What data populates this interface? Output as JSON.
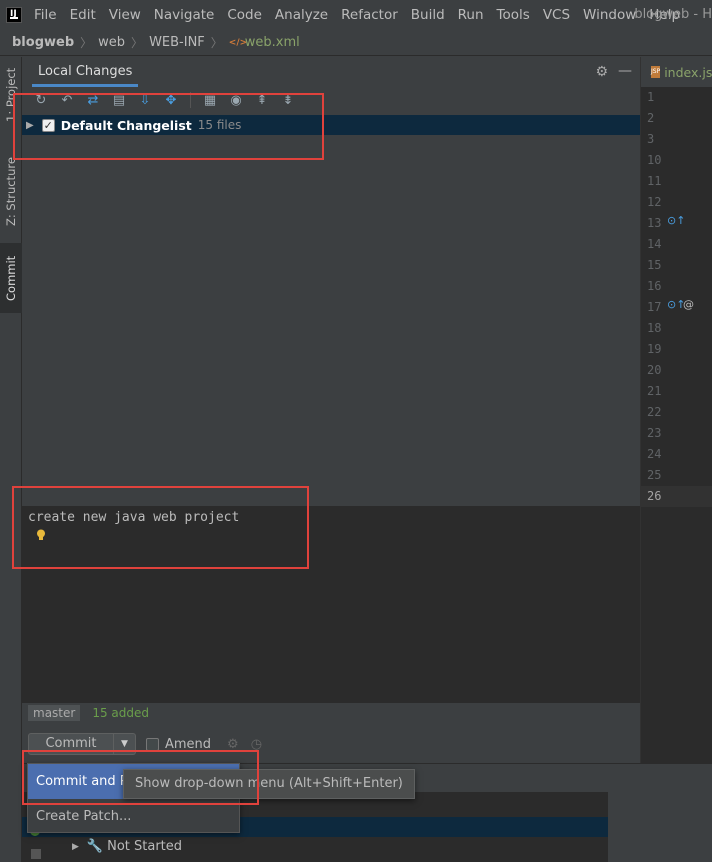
{
  "menubar": {
    "items": [
      "File",
      "Edit",
      "View",
      "Navigate",
      "Code",
      "Analyze",
      "Refactor",
      "Build",
      "Run",
      "Tools",
      "VCS",
      "Window",
      "Help"
    ],
    "window_title": "blogweb - H"
  },
  "breadcrumb": {
    "project": "blogweb",
    "folder1": "web",
    "folder2": "WEB-INF",
    "file": "web.xml"
  },
  "left_strip": {
    "project_tab": "1: Project",
    "structure_tab": "Z: Structure",
    "commit_tab": "Commit"
  },
  "panel": {
    "tab_label": "Local Changes",
    "changelist": {
      "name": "Default Changelist",
      "count": "15 files",
      "checked": true
    },
    "commit_message": "create new java web project",
    "branch": "master",
    "added": "15 added",
    "commit_button": "Commit",
    "amend_label": "Amend"
  },
  "editor": {
    "tab_label": "index.js",
    "line_numbers": [
      "1",
      "2",
      "3",
      "10",
      "11",
      "12",
      "13",
      "14",
      "15",
      "16",
      "17",
      "18",
      "19",
      "20",
      "21",
      "22",
      "23",
      "24",
      "25",
      "26"
    ],
    "current_line": "26"
  },
  "popup": {
    "items": [
      "Commit and Pu",
      "Create Patch..."
    ],
    "tooltip": "Show drop-down menu (Alt+Shift+Enter)"
  },
  "bottom": {
    "tree_item": "Not Started"
  },
  "colors": {
    "accent": "#4b6eaf",
    "selection": "#0d293e",
    "annotation": "#e0423c",
    "added_green": "#6a9e4b"
  }
}
